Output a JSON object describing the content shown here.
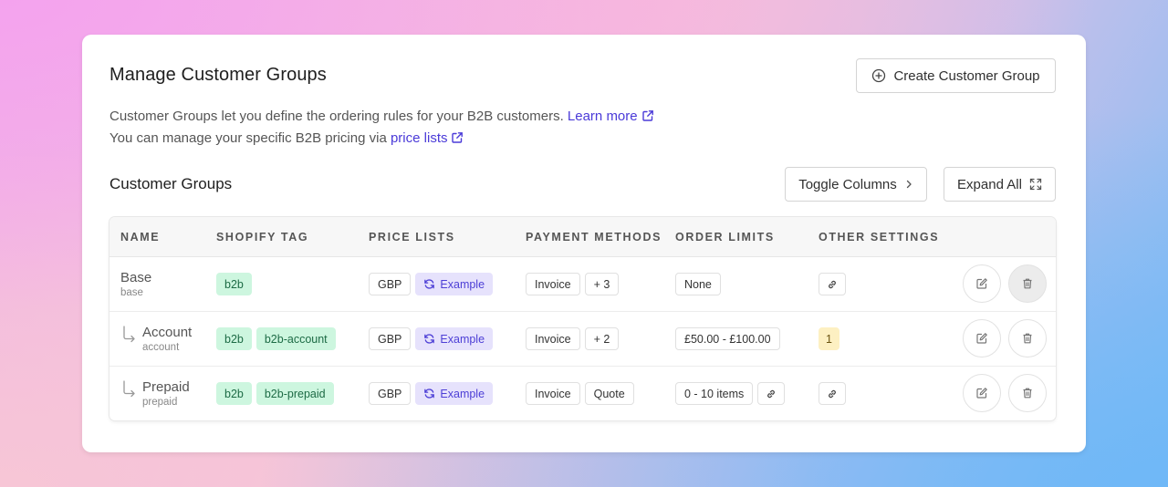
{
  "header": {
    "title": "Manage Customer Groups",
    "create_button": "Create Customer Group"
  },
  "description": {
    "line1_text": "Customer Groups let you define the ordering rules for your B2B customers.",
    "line1_link": "Learn more",
    "line2_text": "You can manage your specific B2B pricing via",
    "line2_link": "price lists"
  },
  "section": {
    "title": "Customer Groups",
    "toggle_columns": "Toggle Columns",
    "expand_all": "Expand All"
  },
  "table": {
    "columns": [
      "NAME",
      "SHOPIFY TAG",
      "PRICE LISTS",
      "PAYMENT METHODS",
      "ORDER LIMITS",
      "OTHER SETTINGS"
    ],
    "rows": [
      {
        "name": "Base",
        "handle": "base",
        "tags": [
          "b2b"
        ],
        "currency": "GBP",
        "price_list": "Example",
        "payment": "Invoice",
        "payment_extra": "+ 3",
        "order_limit": "None",
        "other_count": ""
      },
      {
        "name": "Account",
        "handle": "account",
        "tags": [
          "b2b",
          "b2b-account"
        ],
        "currency": "GBP",
        "price_list": "Example",
        "payment": "Invoice",
        "payment_extra": "+ 2",
        "order_limit": "£50.00 - £100.00",
        "other_count": "1"
      },
      {
        "name": "Prepaid",
        "handle": "prepaid",
        "tags": [
          "b2b",
          "b2b-prepaid"
        ],
        "currency": "GBP",
        "price_list": "Example",
        "payment": "Invoice",
        "payment_extra": "Quote",
        "order_limit": "0 - 10 items",
        "other_count": ""
      }
    ]
  },
  "colors": {
    "accent": "#4a3ad8",
    "tag_green_bg": "#cdf6df",
    "price_list_bg": "#e6e2fc",
    "settings_badge_bg": "#fdf0c2"
  },
  "icons": [
    "plus-circle-icon",
    "external-link-icon",
    "chevron-right-icon",
    "expand-icon",
    "sync-icon",
    "link-icon",
    "edit-icon",
    "trash-icon",
    "indent-arrow-icon"
  ]
}
